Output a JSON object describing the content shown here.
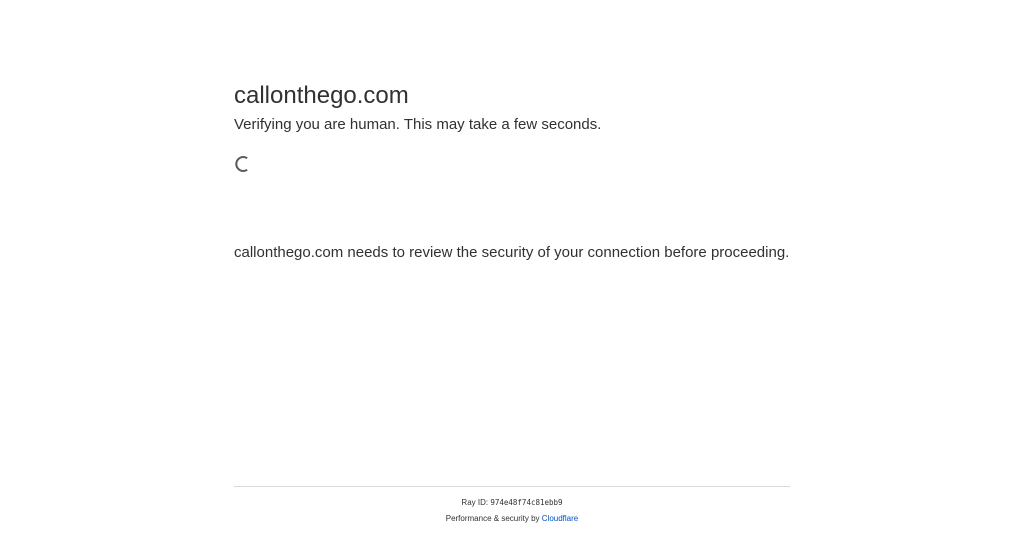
{
  "page": {
    "site_title": "callonthego.com",
    "subtitle": "Verifying you are human. This may take a few seconds.",
    "spinner": "loading-spinner-icon",
    "security_message": "callonthego.com needs to review the security of your connection before proceeding."
  },
  "footer": {
    "ray_label": "Ray ID:",
    "ray_id": "974e48f74c81ebb9",
    "performance_label": "Performance & security by",
    "cloudflare_link": "Cloudflare"
  },
  "colors": {
    "text": "#313131",
    "link": "#0051c3",
    "divider": "#d9d9d9",
    "background": "#ffffff"
  }
}
